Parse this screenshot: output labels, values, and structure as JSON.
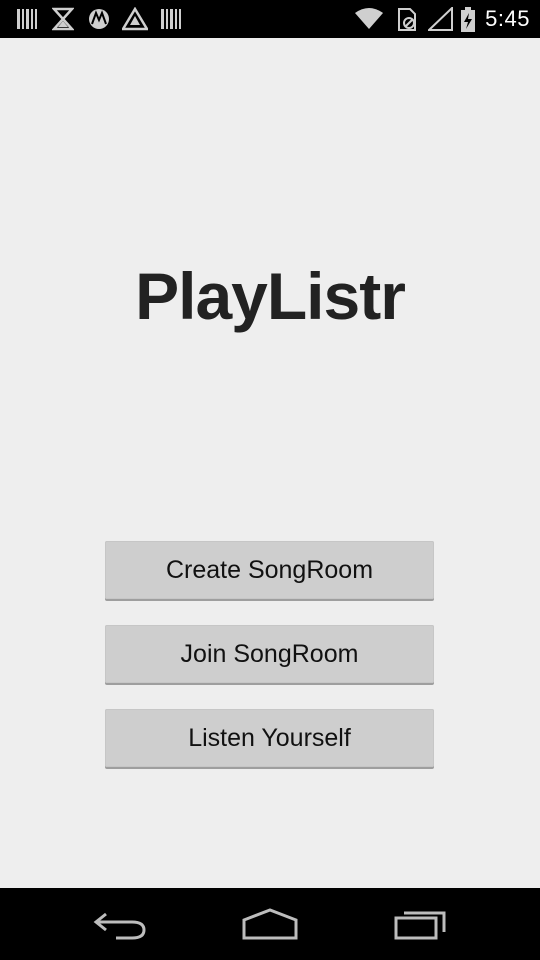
{
  "status_bar": {
    "time": "5:45",
    "left_icons": [
      "barcode-icon",
      "hourglass-icon",
      "motorola-icon",
      "triangle-icon",
      "barcode-icon"
    ],
    "right_icons": [
      "wifi-icon",
      "sim-icon",
      "signal-icon",
      "battery-icon"
    ]
  },
  "app": {
    "title": "PlayListr"
  },
  "buttons": {
    "create": "Create SongRoom",
    "join": "Join SongRoom",
    "listen": "Listen Yourself"
  },
  "nav_bar": {
    "icons": [
      "back-icon",
      "home-icon",
      "recent-apps-icon"
    ]
  },
  "colors": {
    "background": "#eeeeee",
    "button": "#cecece",
    "bars": "#000000"
  }
}
